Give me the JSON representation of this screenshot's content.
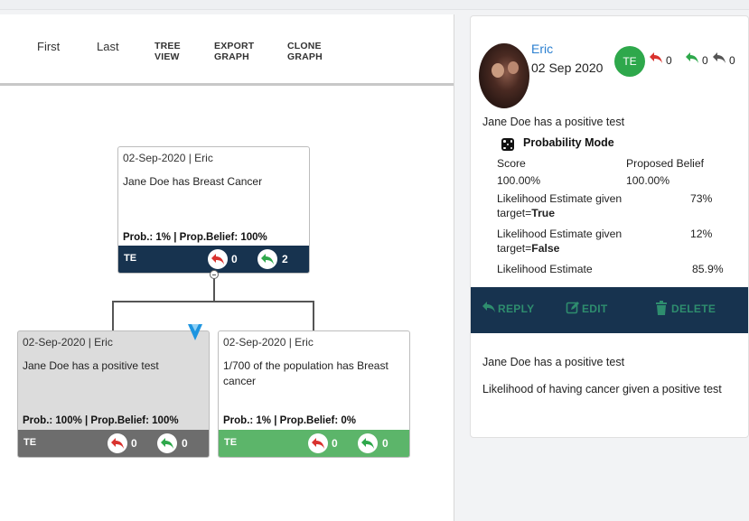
{
  "toolbar": {
    "first": "First",
    "last": "Last",
    "tree_view": [
      "TREE",
      "VIEW"
    ],
    "export_graph": [
      "EXPORT",
      "GRAPH"
    ],
    "clone_graph": [
      "CLONE",
      "GRAPH"
    ]
  },
  "nodes": [
    {
      "header": "02-Sep-2020 | Eric",
      "text": "Jane Doe has Breast Cancer",
      "stats": "Prob.: 1% | Prop.Belief: 100%",
      "tag": "TE",
      "red_count": "0",
      "green_count": "2",
      "bar_color": "#17334f"
    },
    {
      "header": "02-Sep-2020 | Eric",
      "text": "Jane Doe has a positive test",
      "stats": "Prob.: 100% | Prop.Belief: 100%",
      "tag": "TE",
      "red_count": "0",
      "green_count": "0",
      "bar_color": "#6d6d6d"
    },
    {
      "header": "02-Sep-2020 | Eric",
      "text": "1/700 of the population has Breast cancer",
      "stats": "Prob.: 1% | Prop.Belief: 0%",
      "tag": "TE",
      "red_count": "0",
      "green_count": "0",
      "bar_color": "#5cb56a"
    }
  ],
  "detail": {
    "user": "Eric",
    "date": "02 Sep 2020",
    "badge": "TE",
    "counts": {
      "red": "0",
      "green": "0",
      "gray": "0"
    },
    "statement": "Jane Doe has a positive test",
    "mode": "Probability Mode",
    "score_label": "Score",
    "belief_label": "Proposed Belief",
    "score_value": "100.00%",
    "belief_value": "100.00%",
    "lik_true_label": "Likelihood Estimate given",
    "lik_true_target": "target=",
    "lik_true_bold": "True",
    "lik_true_value": "73%",
    "lik_false_label": "Likelihood Estimate given",
    "lik_false_target": "target=",
    "lik_false_bold": "False",
    "lik_false_value": "12%",
    "lik_label": "Likelihood Estimate",
    "lik_value": "85.9%",
    "actions": {
      "reply": "REPLY",
      "edit": "EDIT",
      "delete": "DELETE"
    },
    "lower_title": "Jane Doe has a positive test",
    "lower_text": "Likelihood of having cancer given a positive test"
  },
  "colors": {
    "accent_blue": "#2a7fd0",
    "navy": "#17334f",
    "green": "#2ea84b",
    "red": "#d9322e",
    "action_green": "#2e8d6e"
  }
}
